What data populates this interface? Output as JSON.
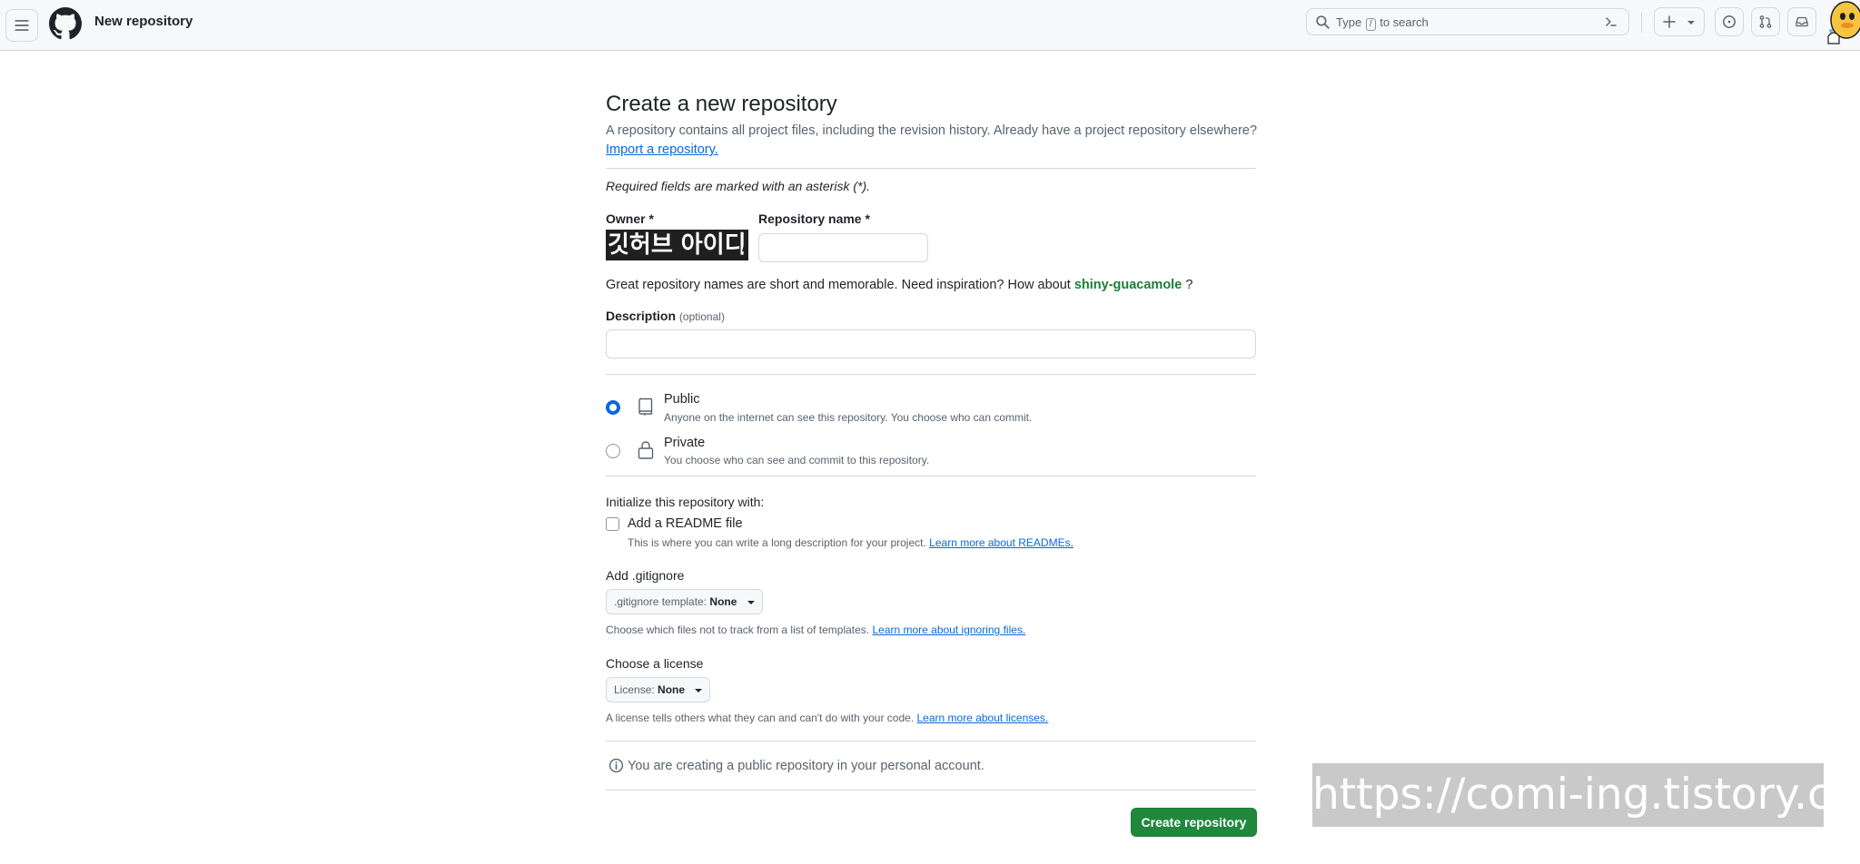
{
  "header": {
    "page_title": "New repository",
    "search_placeholder_prefix": "Type",
    "search_placeholder_key": "/",
    "search_placeholder_suffix": "to search"
  },
  "form": {
    "title": "Create a new repository",
    "subtitle": "A repository contains all project files, including the revision history. Already have a project repository elsewhere?",
    "import_link": "Import a repository.",
    "required_note": "Required fields are marked with an asterisk (*).",
    "owner_label": "Owner *",
    "owner_value": "깃허브 아이디",
    "slash": "/",
    "repo_name_label": "Repository name *",
    "repo_name_value": "",
    "inspiration_text": "Great repository names are short and memorable. Need inspiration? How about",
    "inspiration_suggestion": "shiny-guacamole",
    "inspiration_end": "?",
    "description_label": "Description",
    "description_optional": "(optional)",
    "description_value": ""
  },
  "visibility": {
    "selected": "Public",
    "options": [
      {
        "title": "Public",
        "description": "Anyone on the internet can see this repository. You choose who can commit."
      },
      {
        "title": "Private",
        "description": "You choose who can see and commit to this repository."
      }
    ]
  },
  "initialize": {
    "heading": "Initialize this repository with:",
    "readme_label": "Add a README file",
    "readme_checked": false,
    "readme_desc": "This is where you can write a long description for your project.",
    "readme_link": "Learn more about READMEs."
  },
  "gitignore": {
    "heading": "Add .gitignore",
    "dropdown_prefix": ".gitignore template:",
    "dropdown_value": "None",
    "help": "Choose which files not to track from a list of templates.",
    "help_link": "Learn more about ignoring files."
  },
  "license": {
    "heading": "Choose a license",
    "dropdown_prefix": "License:",
    "dropdown_value": "None",
    "help": "A license tells others what they can and can't do with your code.",
    "help_link": "Learn more about licenses."
  },
  "footer": {
    "info_text": "You are creating a public repository in your personal account.",
    "create_button": "Create repository"
  },
  "watermark": "https://comi-ing.tistory.com",
  "colors": {
    "accent": "#0969da",
    "primary_button": "#1f883d",
    "suggestion": "#1a7f37"
  }
}
